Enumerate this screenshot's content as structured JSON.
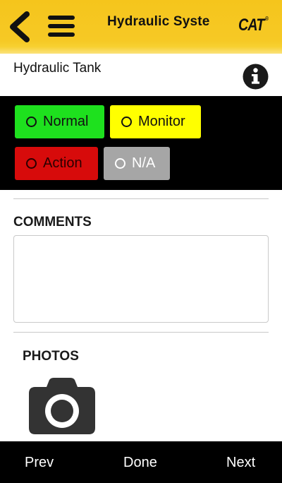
{
  "header": {
    "title": "Hydraulic Syste",
    "logo_text": "CAT",
    "logo_mark": "®",
    "back_icon": "chevron-left-icon",
    "menu_icon": "hamburger-menu-icon",
    "color": "#f6c925"
  },
  "item": {
    "title": "Hydraulic Tank",
    "info_icon": "info-icon"
  },
  "status_options": [
    {
      "label": "Normal",
      "color": "#1ee11e"
    },
    {
      "label": "Monitor",
      "color": "#ffff00"
    },
    {
      "label": "Action",
      "color": "#d70b0b"
    },
    {
      "label": "N/A",
      "color": "#a6a6a6"
    }
  ],
  "comments": {
    "label": "COMMENTS",
    "value": ""
  },
  "photos": {
    "label": "PHOTOS",
    "camera_icon": "camera-icon"
  },
  "footer": {
    "prev_label": "Prev",
    "done_label": "Done",
    "next_label": "Next"
  }
}
